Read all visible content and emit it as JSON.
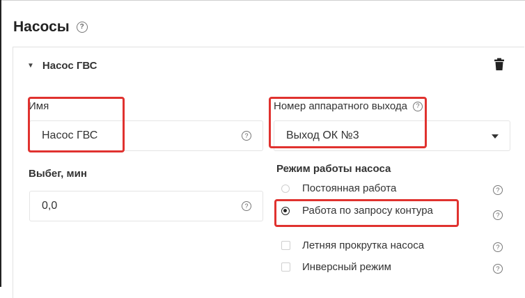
{
  "section": {
    "title": "Насосы"
  },
  "pump": {
    "header": "Насос ГВС",
    "name_label": "Имя",
    "name_value": "Насос ГВС",
    "output_label": "Номер аппаратного выхода",
    "output_value": "Выход ОК №3",
    "runout_label": "Выбег, мин",
    "runout_value": "0,0",
    "mode_label": "Режим работы насоса",
    "modes": [
      {
        "label": "Постоянная работа",
        "selected": false
      },
      {
        "label": "Работа по запросу контура",
        "selected": true
      }
    ],
    "checkboxes": [
      {
        "label": "Летняя прокрутка насоса",
        "checked": false
      },
      {
        "label": "Инверсный режим",
        "checked": false
      }
    ]
  },
  "help_glyph": "?",
  "colors": {
    "highlight": "#e0322f",
    "text": "#333333",
    "border": "#e1e1e1"
  },
  "icons": [
    "help-icon",
    "caret-down-icon",
    "trash-icon",
    "dropdown-arrow-icon"
  ]
}
